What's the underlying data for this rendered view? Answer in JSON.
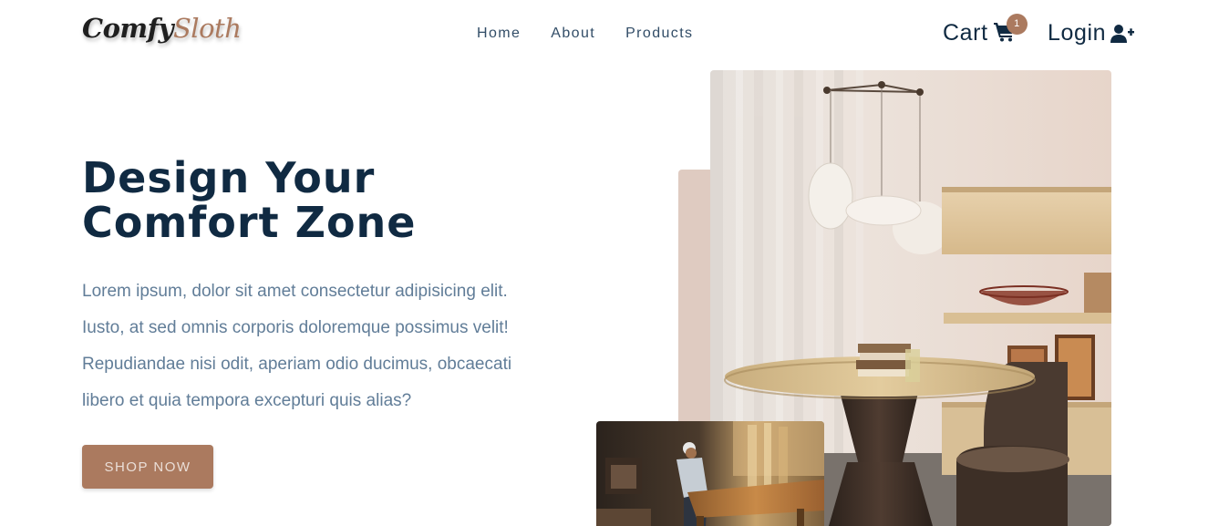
{
  "logo": {
    "part1": "Comfy",
    "part2": "Sloth"
  },
  "nav": {
    "links": [
      {
        "label": "Home"
      },
      {
        "label": "About"
      },
      {
        "label": "Products"
      }
    ]
  },
  "cart": {
    "label": "Cart",
    "count": "1",
    "icon": "shopping-cart-icon"
  },
  "login": {
    "label": "Login",
    "icon": "user-plus-icon"
  },
  "hero": {
    "title_lines": [
      "Design Your",
      "Comfort Zone"
    ],
    "text_lines": [
      "Lorem ipsum, dolor sit amet consectetur adipisicing elit.",
      "Iusto, at sed omnis corporis doloremque possimus velit!",
      "Repudiandae nisi odit, aperiam odio ducimus, obcaecati",
      "libero et quia tempora excepturi quis alias?"
    ],
    "cta": "shop now"
  },
  "colors": {
    "primary": "#ab7a5f",
    "heading": "#102a42",
    "body_text": "#617d98",
    "accent_block": "#dfcbc1"
  }
}
